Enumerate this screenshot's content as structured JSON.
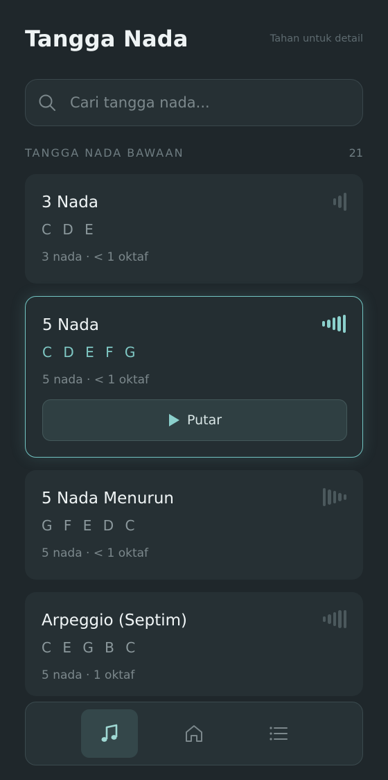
{
  "header": {
    "title": "Tangga Nada",
    "hint": "Tahan untuk detail"
  },
  "search": {
    "placeholder": "Cari tangga nada..."
  },
  "section": {
    "title": "TANGGA NADA BAWAAN",
    "count": "21"
  },
  "scales": [
    {
      "name": "3 Nada",
      "notes": "C D E",
      "meta": "3 nada · < 1 oktaf",
      "bars": [
        10,
        18,
        26
      ],
      "active": false
    },
    {
      "name": "5 Nada",
      "notes": "C D E F G",
      "meta": "5 nada · < 1 oktaf",
      "bars": [
        8,
        12,
        18,
        22,
        26
      ],
      "active": true,
      "play_label": "Putar"
    },
    {
      "name": "5 Nada Menurun",
      "notes": "G F E D C",
      "meta": "5 nada · < 1 oktaf",
      "bars": [
        26,
        22,
        18,
        12,
        8
      ],
      "active": false
    },
    {
      "name": "Arpeggio (Septim)",
      "notes": "C E G B C",
      "meta": "5 nada · 1 oktaf",
      "bars": [
        8,
        14,
        20,
        26,
        26
      ],
      "active": false
    }
  ],
  "nav": {
    "items": [
      "music-note-icon",
      "home-icon",
      "list-icon"
    ],
    "active_index": 0
  },
  "colors": {
    "background": "#1f272b",
    "accent": "#72c4c2",
    "card": "#263034"
  }
}
